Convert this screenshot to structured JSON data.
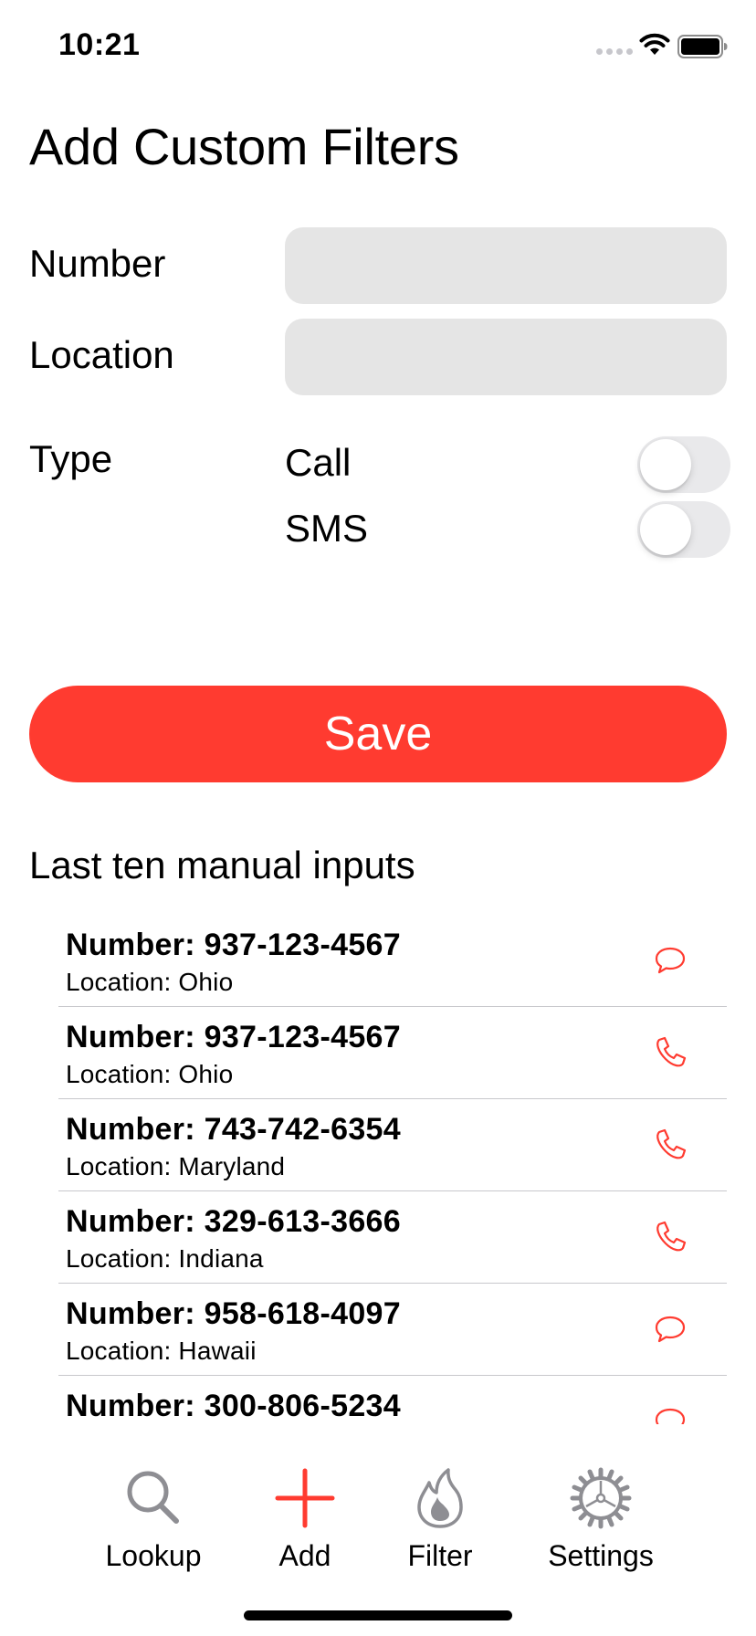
{
  "status_bar": {
    "time": "10:21"
  },
  "title": "Add Custom Filters",
  "form": {
    "number_label": "Number",
    "number_value": "",
    "location_label": "Location",
    "location_value": "",
    "type_label": "Type",
    "call_label": "Call",
    "call_on": false,
    "sms_label": "SMS",
    "sms_on": false
  },
  "save_label": "Save",
  "recent": {
    "title": "Last ten manual inputs",
    "items": [
      {
        "number": "Number: 937-123-4567",
        "location": "Location: Ohio",
        "icon": "message-icon"
      },
      {
        "number": "Number: 937-123-4567",
        "location": "Location: Ohio",
        "icon": "phone-icon"
      },
      {
        "number": "Number: 743-742-6354",
        "location": "Location: Maryland",
        "icon": "phone-icon"
      },
      {
        "number": "Number: 329-613-3666",
        "location": "Location: Indiana",
        "icon": "phone-icon"
      },
      {
        "number": "Number: 958-618-4097",
        "location": "Location: Hawaii",
        "icon": "message-icon"
      },
      {
        "number": "Number: 300-806-5234",
        "location": "",
        "icon": "message-icon"
      }
    ]
  },
  "tabs": [
    {
      "label": "Lookup",
      "icon": "search-icon"
    },
    {
      "label": "Add",
      "icon": "plus-icon"
    },
    {
      "label": "Filter",
      "icon": "flame-icon"
    },
    {
      "label": "Settings",
      "icon": "gear-icon"
    }
  ],
  "colors": {
    "accent": "#ff3b30",
    "input_bg": "#e5e5e5",
    "toggle_off": "#e9e9eb",
    "tab_icon_gray": "#8e8e93"
  }
}
